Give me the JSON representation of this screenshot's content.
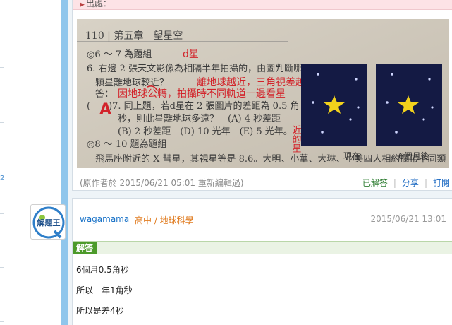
{
  "sidebar": {
    "mini_label": "2"
  },
  "question": {
    "source_label": "出處：",
    "photo": {
      "page_header": "110 | 第五章　望星空",
      "lines": [
        "◎6 ～ 7 為題組",
        "6. 右邊 2 張天文影像為相隔半年拍攝的，由圖判斷哪一",
        "顆星離地球較近？",
        "答：",
        "(　　)7. 同上題，若d星在 2 張圖片的差距為 0.5 角",
        "秒，則此星離地球多遠？　(A) 4 秒差距",
        "(B) 2 秒差距　(D) 10 光年　(E) 5 光年。",
        "◎8 ～ 10 題為題組",
        "飛馬座附近的 X 彗星，其視星等是 8.6。大明、小華、大琳、小美四人相約攔帶不同類"
      ],
      "handwriting": {
        "star_label": "d星",
        "note_top": "離地球越近，三角視差越大",
        "note_answer": "因地球公轉，拍攝時不同軌道一邊看星",
        "note_right": "近的星",
        "answer_mark": "A"
      },
      "panel_labels": [
        "現在",
        "6個月後"
      ]
    },
    "edit_note": "(原作者於 2015/06/21 05:01 重新編輯過)",
    "actions": {
      "solved": "已解答",
      "share": "分享",
      "subscribe": "訂閱"
    }
  },
  "answer": {
    "username": "wagamama",
    "category": "高中 / 地球科學",
    "timestamp": "2015/06/21 13:01",
    "badge": "解答",
    "lines": [
      "6個月0.5角秒",
      "所以一年1角秒",
      "所以是差4秒"
    ]
  },
  "avatar": {
    "text": "解題王"
  },
  "colors": {
    "accent_bar": "#8fc6ec",
    "source_bar": "#fde3e6",
    "badge_green": "#4c9a2a",
    "username_blue": "#1a73c8",
    "category_orange": "#e07b1f"
  }
}
